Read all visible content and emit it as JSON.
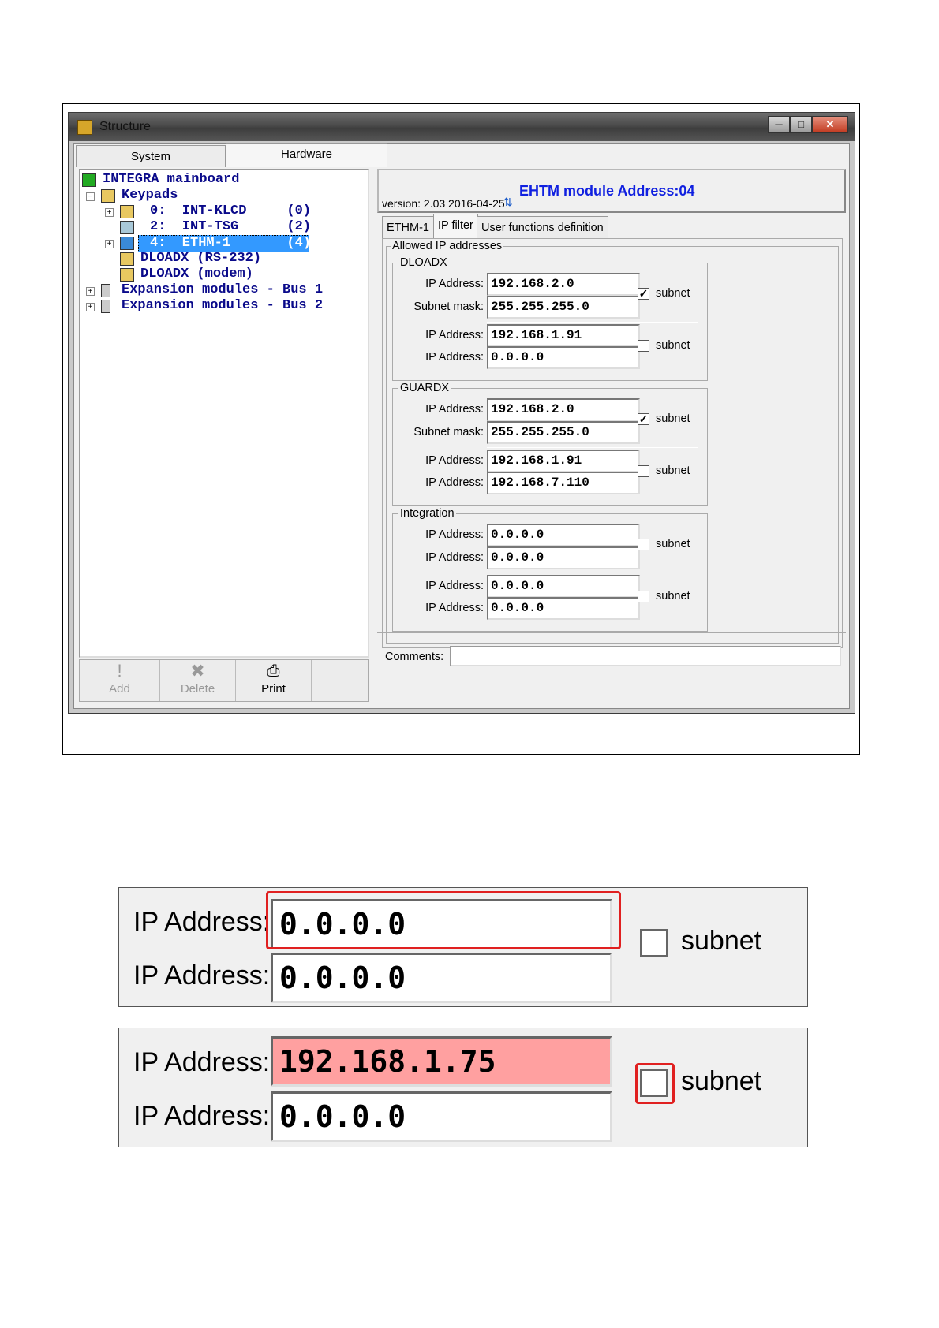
{
  "window": {
    "title": "Structure"
  },
  "top_tabs": [
    "System",
    "Hardware"
  ],
  "tree": [
    {
      "label": "INTEGRA mainboard"
    },
    {
      "label": "Keypads"
    },
    {
      "label": "0:  INT-KLCD     (0)"
    },
    {
      "label": "2:  INT-TSG      (2)"
    },
    {
      "label": "4:  ETHM-1       (4)",
      "selected": true
    },
    {
      "label": "DLOADX (RS-232)"
    },
    {
      "label": "DLOADX (modem)"
    },
    {
      "label": "Expansion modules - Bus 1"
    },
    {
      "label": "Expansion modules - Bus 2"
    }
  ],
  "toolbar": {
    "add": "Add",
    "delete": "Delete",
    "print": "Print"
  },
  "header": {
    "version": "version: 2.03 2016-04-25",
    "module": "EHTM module Address:04"
  },
  "right_tabs": [
    "ETHM-1",
    "IP filter",
    "User functions definition"
  ],
  "allowed_label": "Allowed IP addresses",
  "groups": [
    {
      "name": "DLOADX",
      "rows": [
        {
          "label": "IP Address:",
          "value": "192.168.2.0"
        },
        {
          "label": "Subnet mask:",
          "value": "255.255.255.0"
        },
        {
          "label": "IP Address:",
          "value": "192.168.1.91"
        },
        {
          "label": "IP Address:",
          "value": "0.0.0.0"
        }
      ],
      "subnets": [
        true,
        false
      ]
    },
    {
      "name": "GUARDX",
      "rows": [
        {
          "label": "IP Address:",
          "value": "192.168.2.0"
        },
        {
          "label": "Subnet mask:",
          "value": "255.255.255.0"
        },
        {
          "label": "IP Address:",
          "value": "192.168.1.91"
        },
        {
          "label": "IP Address:",
          "value": "192.168.7.110"
        }
      ],
      "subnets": [
        true,
        false
      ]
    },
    {
      "name": "Integration",
      "rows": [
        {
          "label": "IP Address:",
          "value": "0.0.0.0"
        },
        {
          "label": "IP Address:",
          "value": "0.0.0.0"
        },
        {
          "label": "IP Address:",
          "value": "0.0.0.0"
        },
        {
          "label": "IP Address:",
          "value": "0.0.0.0"
        }
      ],
      "subnets": [
        false,
        false
      ]
    }
  ],
  "subnet_label": "subnet",
  "comments_label": "Comments:",
  "zoom1": {
    "label1": "IP Address:",
    "value1": "0.0.0.0",
    "label2": "IP Address:",
    "value2": "0.0.0.0",
    "subnet": "subnet"
  },
  "zoom2": {
    "label1": "IP Address:",
    "value1": "192.168.1.75",
    "label2": "IP Address:",
    "value2": "0.0.0.0",
    "subnet": "subnet",
    "error_color": "#ffa0a0"
  }
}
